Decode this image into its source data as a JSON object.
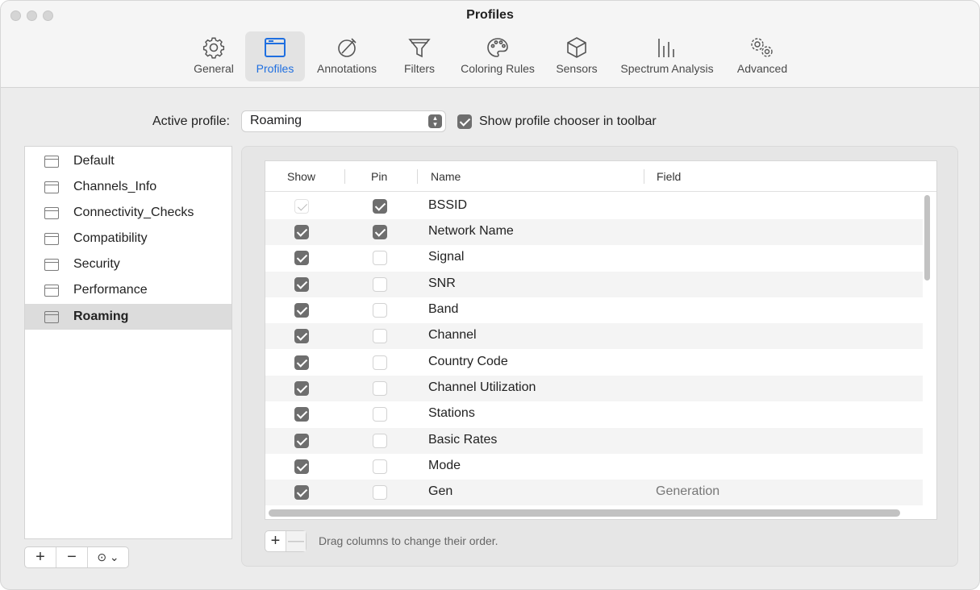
{
  "window": {
    "title": "Profiles"
  },
  "toolbar": {
    "items": [
      {
        "label": "General",
        "icon": "gear-icon"
      },
      {
        "label": "Profiles",
        "icon": "window-icon",
        "active": true
      },
      {
        "label": "Annotations",
        "icon": "annotation-icon"
      },
      {
        "label": "Filters",
        "icon": "funnel-icon"
      },
      {
        "label": "Coloring Rules",
        "icon": "palette-icon"
      },
      {
        "label": "Sensors",
        "icon": "cube-icon"
      },
      {
        "label": "Spectrum Analysis",
        "icon": "spectrum-icon"
      },
      {
        "label": "Advanced",
        "icon": "gears-icon"
      }
    ]
  },
  "active_profile": {
    "label": "Active profile:",
    "value": "Roaming",
    "toolbar_chooser_label": "Show profile chooser in toolbar",
    "toolbar_chooser_checked": true
  },
  "profiles": {
    "items": [
      "Default",
      "Channels_Info",
      "Connectivity_Checks",
      "Compatibility",
      "Security",
      "Performance",
      "Roaming"
    ],
    "selected": "Roaming",
    "add_label": "+",
    "remove_label": "−",
    "more_label": "⊙ ⌄"
  },
  "columns_table": {
    "headers": {
      "show": "Show",
      "pin": "Pin",
      "name": "Name",
      "field": "Field"
    },
    "rows": [
      {
        "show": "dim",
        "pin": true,
        "name": "BSSID",
        "field": ""
      },
      {
        "show": true,
        "pin": true,
        "name": "Network Name",
        "field": ""
      },
      {
        "show": true,
        "pin": false,
        "name": "Signal",
        "field": ""
      },
      {
        "show": true,
        "pin": false,
        "name": "SNR",
        "field": ""
      },
      {
        "show": true,
        "pin": false,
        "name": "Band",
        "field": ""
      },
      {
        "show": true,
        "pin": false,
        "name": "Channel",
        "field": ""
      },
      {
        "show": true,
        "pin": false,
        "name": "Country Code",
        "field": ""
      },
      {
        "show": true,
        "pin": false,
        "name": "Channel Utilization",
        "field": ""
      },
      {
        "show": true,
        "pin": false,
        "name": "Stations",
        "field": ""
      },
      {
        "show": true,
        "pin": false,
        "name": "Basic Rates",
        "field": ""
      },
      {
        "show": true,
        "pin": false,
        "name": "Mode",
        "field": ""
      },
      {
        "show": true,
        "pin": false,
        "name": "Gen",
        "field": "Generation"
      }
    ],
    "add_label": "+",
    "remove_label": "—",
    "hint": "Drag columns to change their order."
  }
}
